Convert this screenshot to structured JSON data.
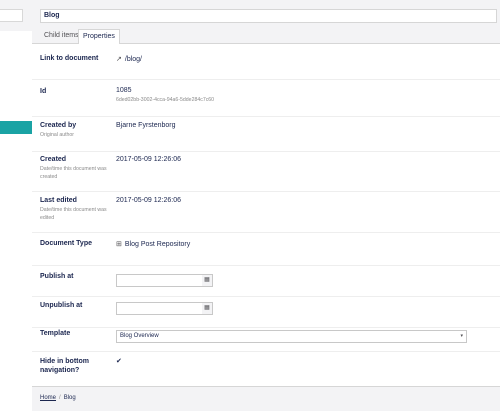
{
  "header": {
    "name_value": "Blog",
    "tabs": [
      {
        "label": "Child items"
      },
      {
        "label": "Properties"
      }
    ]
  },
  "properties": {
    "link": {
      "label": "Link to document",
      "value": "/blog/"
    },
    "id": {
      "label": "Id",
      "value": "1085",
      "guid": "6ded02bb-3002-4cca-94a6-5dde284c7c60"
    },
    "created_by": {
      "label": "Created by",
      "desc": "Original author",
      "value": "Bjarne Fyrstenborg"
    },
    "created": {
      "label": "Created",
      "desc": "Date/time this document was created",
      "value": "2017-05-09 12:26:06"
    },
    "last_edited": {
      "label": "Last edited",
      "desc": "Date/time this document was edited",
      "value": "2017-05-09 12:26:06"
    },
    "doc_type": {
      "label": "Document Type",
      "value": "Blog Post Repository"
    },
    "publish_at": {
      "label": "Publish at",
      "value": ""
    },
    "unpublish_at": {
      "label": "Unpublish at",
      "value": ""
    },
    "template": {
      "label": "Template",
      "selected": "Blog Overview"
    },
    "hide_nav": {
      "label_line1": "Hide in bottom",
      "label_line2": "navigation?",
      "checked": true
    }
  },
  "footer": {
    "crumbs": [
      {
        "label": "Home"
      },
      {
        "label": "Blog"
      }
    ],
    "separator": "/"
  },
  "colors": {
    "accent": "#1aa3a4",
    "text": "#1b264f"
  },
  "icons": {
    "link": "external-link-icon",
    "doctype": "grid-icon",
    "calendar": "calendar-icon",
    "caret": "caret-down-icon",
    "check": "checkmark-icon"
  }
}
